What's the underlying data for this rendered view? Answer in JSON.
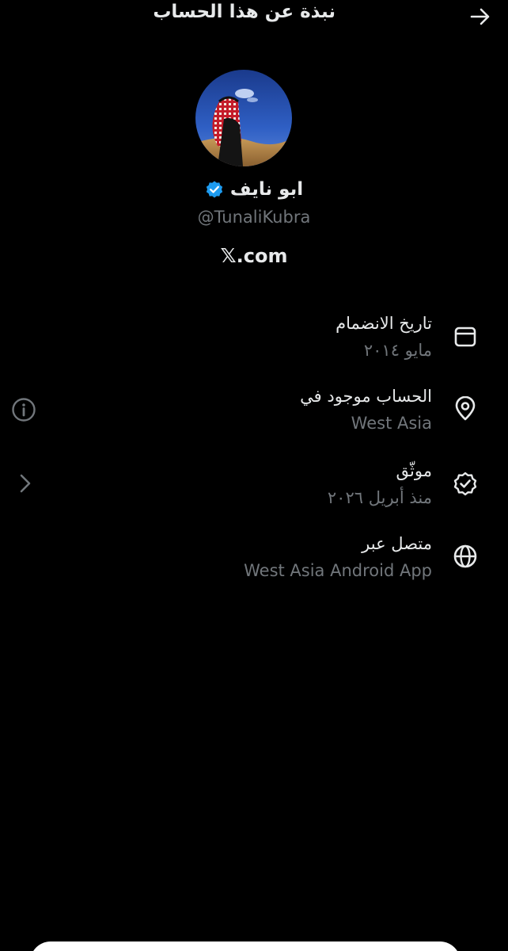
{
  "header": {
    "title": "نبذة عن هذا الحساب",
    "back_icon": "arrow-right-icon"
  },
  "profile": {
    "display_name": "ابو نايف",
    "handle": "@TunaliKubra",
    "verified_color": "#1d9bf0",
    "site_x": "𝕏",
    "site_domain": ".com"
  },
  "details": [
    {
      "icon": "calendar-icon",
      "label": "تاريخ الانضمام",
      "value": "مايو ٢٠١٤"
    },
    {
      "icon": "location-pin-icon",
      "label": "الحساب موجود في",
      "value": "West Asia"
    },
    {
      "icon": "verified-check-icon",
      "label": "موثّق",
      "value": "منذ أبريل ٢٠٢٦"
    },
    {
      "icon": "globe-icon",
      "label": "متصل عبر",
      "value": "West Asia Android App"
    }
  ],
  "colors": {
    "background": "#000000",
    "primary_text": "#e7e9ea",
    "secondary_text": "#71767b",
    "accent": "#1d9bf0"
  }
}
